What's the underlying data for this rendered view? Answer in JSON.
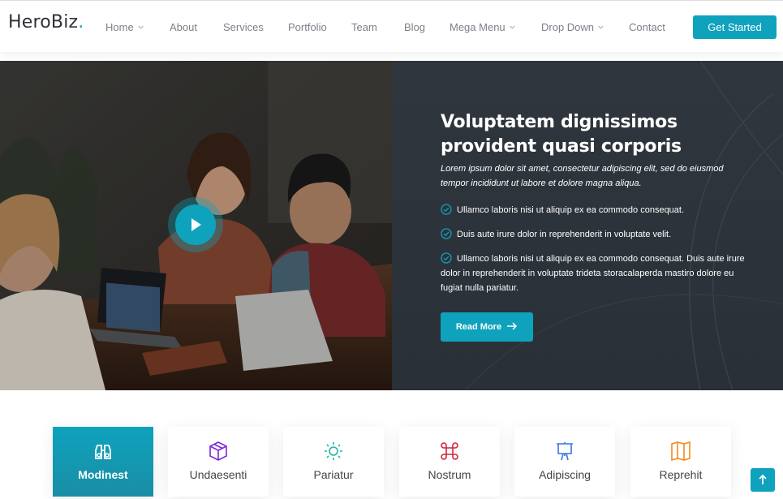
{
  "brand": {
    "name": "HeroBiz",
    "dot": ".",
    "accent": "#0ea2bd"
  },
  "nav": {
    "items": [
      {
        "label": "Home",
        "dropdown": true
      },
      {
        "label": "About",
        "dropdown": false
      },
      {
        "label": "Services",
        "dropdown": false
      },
      {
        "label": "Portfolio",
        "dropdown": false
      },
      {
        "label": "Team",
        "dropdown": false
      },
      {
        "label": "Blog",
        "dropdown": false
      },
      {
        "label": "Mega Menu",
        "dropdown": true
      },
      {
        "label": "Drop Down",
        "dropdown": true
      },
      {
        "label": "Contact",
        "dropdown": false
      }
    ],
    "cta": "Get Started"
  },
  "hero": {
    "play_icon": "play-icon",
    "title": "Voluptatem dignissimos provident quasi corporis",
    "subtitle": "Lorem ipsum dolor sit amet, consectetur adipiscing elit, sed do eiusmod tempor incididunt ut labore et dolore magna aliqua.",
    "checklist": [
      "Ullamco laboris nisi ut aliquip ex ea commodo consequat.",
      "Duis aute irure dolor in reprehenderit in voluptate velit.",
      "Ullamco laboris nisi ut aliquip ex ea commodo consequat. Duis aute irure dolor in reprehenderit in voluptate trideta storacalaperda mastiro dolore eu fugiat nulla pariatur."
    ],
    "button": "Read More"
  },
  "features": [
    {
      "label": "Modinest",
      "icon": "binoculars-icon",
      "color": "#ffffff",
      "active": true
    },
    {
      "label": "Undaesenti",
      "icon": "box-icon",
      "color": "#7b27d8",
      "active": false
    },
    {
      "label": "Pariatur",
      "icon": "sun-icon",
      "color": "#21b69f",
      "active": false
    },
    {
      "label": "Nostrum",
      "icon": "command-icon",
      "color": "#d3253c",
      "active": false
    },
    {
      "label": "Adipiscing",
      "icon": "easel-icon",
      "color": "#3b76e1",
      "active": false
    },
    {
      "label": "Reprehit",
      "icon": "map-icon",
      "color": "#f08c1d",
      "active": false
    }
  ],
  "back_to_top_icon": "arrow-up-icon"
}
